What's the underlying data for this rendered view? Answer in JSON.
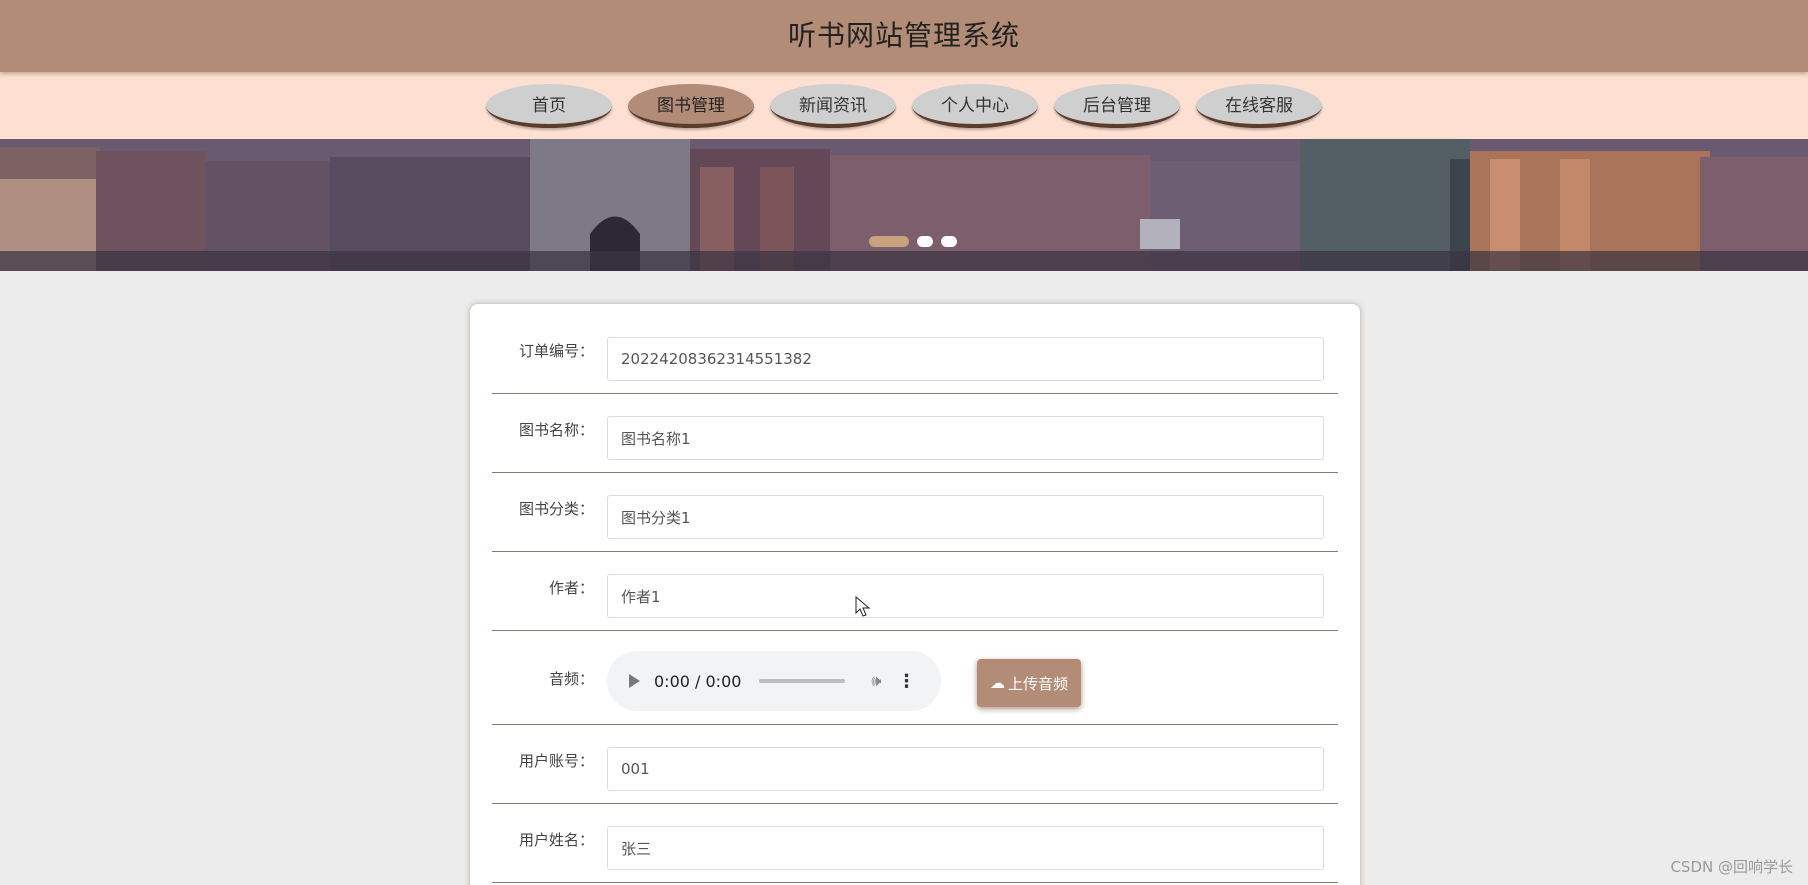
{
  "header": {
    "title": "听书网站管理系统"
  },
  "nav": {
    "items": [
      {
        "label": "首页",
        "active": false
      },
      {
        "label": "图书管理",
        "active": true
      },
      {
        "label": "新闻资讯",
        "active": false
      },
      {
        "label": "个人中心",
        "active": false
      },
      {
        "label": "后台管理",
        "active": false
      },
      {
        "label": "在线客服",
        "active": false
      }
    ]
  },
  "banner": {
    "slide_count": 3,
    "active_slide": 1
  },
  "form": {
    "order_no": {
      "label": "订单编号：",
      "value": "20224208362314551382"
    },
    "book_name": {
      "label": "图书名称：",
      "value": "图书名称1"
    },
    "book_category": {
      "label": "图书分类：",
      "value": "图书分类1"
    },
    "author": {
      "label": "作者：",
      "value": "作者1"
    },
    "audio": {
      "label": "音频：",
      "time": "0:00 / 0:00",
      "upload_label": "上传音频"
    },
    "user_account": {
      "label": "用户账号：",
      "value": "001"
    },
    "user_name": {
      "label": "用户姓名：",
      "value": "张三"
    }
  },
  "watermark": "CSDN @回响学长",
  "colors": {
    "accent": "#b38c77",
    "nav_bg": "#fde0d1",
    "page_bg": "#ececec"
  }
}
